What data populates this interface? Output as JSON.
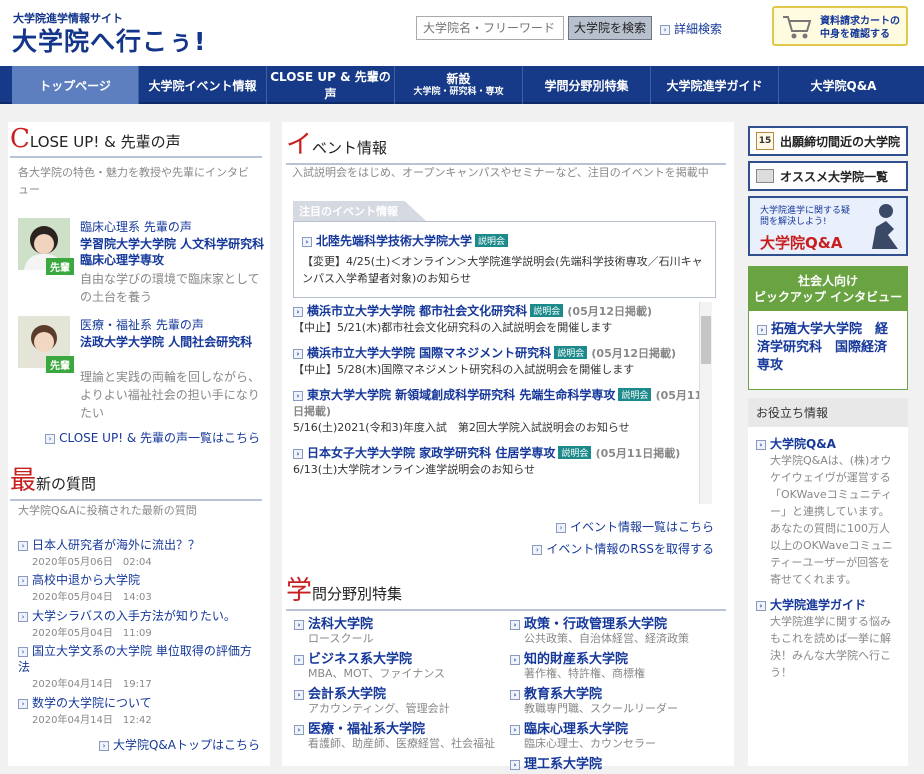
{
  "header": {
    "logo_sub": "大学院進学情報サイト",
    "logo_main": "大学院へ行こぅ!",
    "search_placeholder": "大学院名・フリーワード",
    "search_button": "大学院を検索",
    "advanced": "詳細検索",
    "cart_line1": "資料請求カートの",
    "cart_line2": "中身を確認する"
  },
  "nav": {
    "items": [
      {
        "label": "トップページ"
      },
      {
        "label": "大学院イベント情報"
      },
      {
        "label": "CLOSE UP & 先輩の声"
      },
      {
        "label": "新設",
        "sub": "大学院・研究科・専攻"
      },
      {
        "label": "学問分野別特集"
      },
      {
        "label": "大学院進学ガイド"
      },
      {
        "label": "大学院Q&A"
      }
    ]
  },
  "closeup": {
    "title_first": "C",
    "title_rest": "LOSE UP! & 先輩の声",
    "desc": "各大学院の特色・魅力を教授や先輩にインタビュー",
    "voices": [
      {
        "category": "臨床心理系 先輩の声",
        "title": "学習院大学大学院 人文科学研究科　臨床心理学専攻",
        "text": "自由な学びの環境で臨床家としての土台を養う",
        "badge": "先輩"
      },
      {
        "category": "医療・福祉系 先輩の声",
        "title": "法政大学大学院 人間社会研究科",
        "text": "理論と実践の両輪を回しながら、よりよい福祉社会の担い手になりたい",
        "badge": "先輩"
      }
    ],
    "more": "CLOSE UP! & 先輩の声一覧はこちら"
  },
  "questions": {
    "title_first": "最",
    "title_rest": "新の質問",
    "desc": "大学院Q&Aに投稿された最新の質問",
    "items": [
      {
        "title": "日本人研究者が海外に流出？？",
        "date": "2020年05月06日　02:04"
      },
      {
        "title": "高校中退から大学院",
        "date": "2020年05月04日　14:03"
      },
      {
        "title": "大学シラバスの入手方法が知りたい。",
        "date": "2020年05月04日　11:09"
      },
      {
        "title": "国立大学文系の大学院 単位取得の評価方法",
        "date": "2020年04月14日　19:17"
      },
      {
        "title": "数学の大学院について",
        "date": "2020年04月14日　12:42"
      }
    ],
    "more": "大学院Q&Aトップはこちら"
  },
  "events": {
    "title_first": "イ",
    "title_rest": "ベント情報",
    "desc": "入試説明会をはじめ、オープンキャンパスやセミナーなど、注目のイベントを掲載中",
    "focus_tab": "注目のイベント情報",
    "setsumei": "説明会",
    "focus": {
      "title": "北陸先端科学技術大学院大学",
      "text": "【変更】4/25(土)＜オンライン＞大学院進学説明会(先端科学技術専攻／石川キャンパス入学希望者対象)のお知らせ"
    },
    "list": [
      {
        "title": "横浜市立大学大学院 都市社会文化研究科",
        "date": "(05月12日掲載)",
        "text": "【中止】5/21(木)都市社会文化研究科の入試説明会を開催します"
      },
      {
        "title": "横浜市立大学大学院 国際マネジメント研究科",
        "date": "(05月12日掲載)",
        "text": "【中止】5/28(木)国際マネジメント研究科の入試説明会を開催します"
      },
      {
        "title": "東京大学大学院 新領域創成科学研究科 先端生命科学専攻",
        "date": "(05月11日掲載)",
        "text": "5/16(土)2021(令和3)年度入試　第2回大学院入試説明会のお知らせ"
      },
      {
        "title": "日本女子大学大学院 家政学研究科 住居学専攻",
        "date": "(05月11日掲載)",
        "text": "6/13(土)大学院オンライン進学説明会のお知らせ"
      }
    ],
    "more1": "イベント情報一覧はこちら",
    "more2": "イベント情報のRSSを取得する"
  },
  "fields": {
    "title_first": "学",
    "title_rest": "問分野別特集",
    "left": [
      {
        "title": "法科大学院",
        "sub": "ロースクール"
      },
      {
        "title": "ビジネス系大学院",
        "sub": "MBA、MOT、ファイナンス"
      },
      {
        "title": "会計系大学院",
        "sub": "アカウンティング、管理会計"
      },
      {
        "title": "医療・福祉系大学院",
        "sub": "看護師、助産師、医療経営、社会福祉"
      }
    ],
    "right": [
      {
        "title": "政策・行政管理系大学院",
        "sub": "公共政策、自治体経営、経済政策"
      },
      {
        "title": "知的財産系大学院",
        "sub": "著作権、特許権、商標権"
      },
      {
        "title": "教育系大学院",
        "sub": "教職専門職、スクールリーダー"
      },
      {
        "title": "臨床心理系大学院",
        "sub": "臨床心理士、カウンセラー"
      },
      {
        "title": "理工系大学院",
        "sub": ""
      }
    ]
  },
  "right": {
    "deadline": "出願締切間近の大学院",
    "recommend": "オススメ大学院一覧",
    "qa_banner_small": "大学院進学に関する疑問を解決しよう!",
    "qa_banner_big": "大学院Q&A",
    "interview_head1": "社会人向け",
    "interview_head2": "ピックアップ インタビュー",
    "interview_link": "拓殖大学大学院　経済学研究科　国際経済専攻",
    "help_head": "お役立ち情報",
    "help_items": [
      {
        "title": "大学院Q&A",
        "text": "大学院Q&Aは、(株)オウケイウェイヴが運営する「OKWaveコミュニティー」と連携しています。あなたの質問に100万人以上のOKWaveコミュニティーユーザーが回答を寄せてくれます。"
      },
      {
        "title": "大学院進学ガイド",
        "text": "大学院進学に関する悩みもこれを読めば一挙に解決！みんな大学院へ行こう！"
      }
    ]
  },
  "colors": {
    "nav": "#163a87",
    "link": "#15389a",
    "accent_red": "#c81e1e",
    "green": "#6aa341"
  }
}
